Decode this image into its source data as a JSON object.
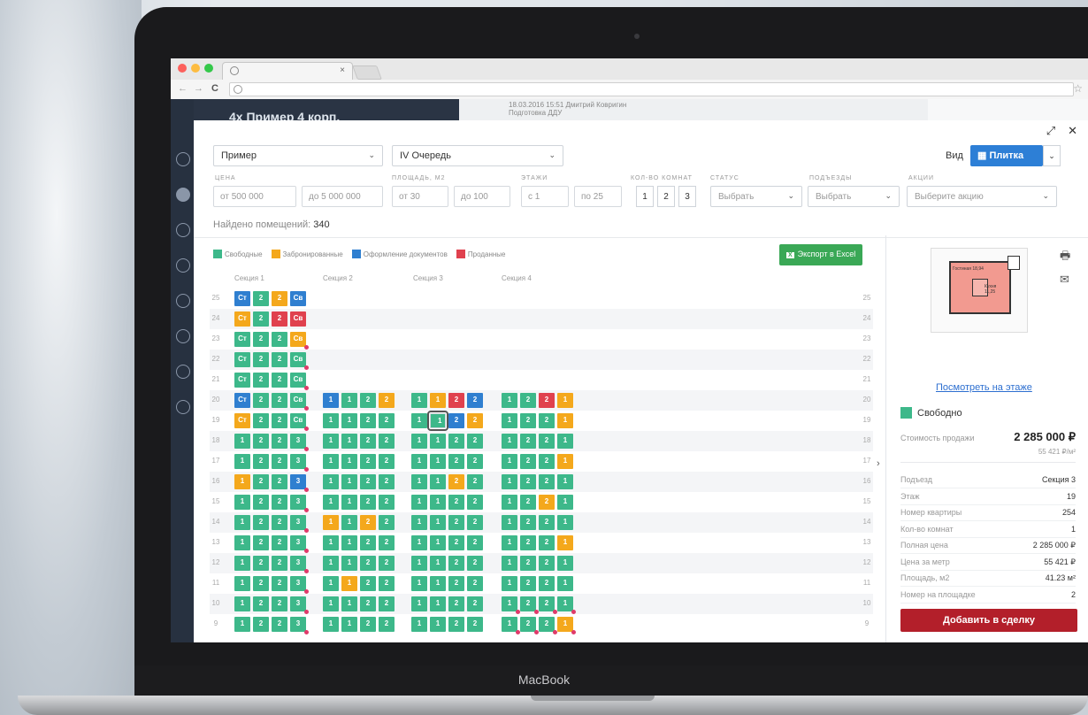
{
  "device": {
    "brand": "MacBook"
  },
  "browser": {
    "tab_close": "×",
    "nav_back": "←",
    "nav_forward": "→",
    "nav_reload": "C",
    "bookmark": "☆"
  },
  "behind": {
    "project_title": "4x Пример 4 корп.",
    "event_line1": "18.03.2016 15:51 Дмитрий Ковригин",
    "event_line2": "Подготовка ДДУ"
  },
  "modal": {
    "expand_icon": "⤢",
    "close_icon": "✕",
    "project_select": "Пример",
    "queue_select": "IV Очередь",
    "view": {
      "label": "Вид",
      "button": "Плитка"
    },
    "filters": {
      "price": {
        "label": "ЦЕНА",
        "from": "от 500 000",
        "to": "до 5 000 000"
      },
      "area": {
        "label": "ПЛОЩАДЬ, М2",
        "from": "от 30",
        "to": "до 100"
      },
      "floors": {
        "label": "ЭТАЖИ",
        "from": "с 1",
        "to": "по 25"
      },
      "rooms": {
        "label": "КОЛ-ВО КОМНАТ",
        "options": [
          "1",
          "2",
          "3"
        ]
      },
      "status": {
        "label": "СТАТУС",
        "placeholder": "Выбрать"
      },
      "entrances": {
        "label": "ПОДЪЕЗДЫ",
        "placeholder": "Выбрать"
      },
      "promo": {
        "label": "АКЦИИ",
        "placeholder": "Выберите акцию"
      }
    },
    "found": {
      "label": "Найдено помещений:",
      "count": "340"
    },
    "legend": [
      {
        "label": "Свободные",
        "color": "#3db88a"
      },
      {
        "label": "Забронированные",
        "color": "#f4a81c"
      },
      {
        "label": "Оформление документов",
        "color": "#2f7fd0"
      },
      {
        "label": "Проданные",
        "color": "#e0414e"
      }
    ],
    "export_button": "Экспорт в Excel",
    "export_badge": "X",
    "sections": [
      "Секция 1",
      "Секция 2",
      "Секция 3",
      "Секция 4"
    ],
    "floors": [
      {
        "n": "25",
        "cells": [
          [
            "Ст",
            "b"
          ],
          [
            "2",
            "g"
          ],
          [
            "2",
            "o"
          ],
          [
            "Св",
            "b"
          ]
        ]
      },
      {
        "n": "24",
        "cells": [
          [
            "Ст",
            "o"
          ],
          [
            "2",
            "g"
          ],
          [
            "2",
            "r"
          ],
          [
            "Св",
            "r"
          ]
        ]
      },
      {
        "n": "23",
        "cells": [
          [
            "Ст",
            "g"
          ],
          [
            "2",
            "g"
          ],
          [
            "2",
            "g"
          ],
          [
            "Св",
            "o"
          ]
        ]
      },
      {
        "n": "22",
        "cells": [
          [
            "Ст",
            "g"
          ],
          [
            "2",
            "g"
          ],
          [
            "2",
            "g"
          ],
          [
            "Св",
            "g"
          ]
        ]
      },
      {
        "n": "21",
        "cells": [
          [
            "Ст",
            "g"
          ],
          [
            "2",
            "g"
          ],
          [
            "2",
            "g"
          ],
          [
            "Св",
            "g"
          ]
        ]
      },
      {
        "n": "20",
        "cells": [
          [
            "Ст",
            "b"
          ],
          [
            "2",
            "g"
          ],
          [
            "2",
            "g"
          ],
          [
            "Св",
            "g"
          ],
          [
            "1",
            "b"
          ],
          [
            "1",
            "g"
          ],
          [
            "2",
            "g"
          ],
          [
            "2",
            "o"
          ],
          [
            "1",
            "g"
          ],
          [
            "1",
            "o"
          ],
          [
            "2",
            "r"
          ],
          [
            "2",
            "b"
          ],
          [
            "1",
            "g"
          ],
          [
            "2",
            "g"
          ],
          [
            "2",
            "r"
          ],
          [
            "1",
            "o"
          ]
        ]
      },
      {
        "n": "19",
        "cells": [
          [
            "Ст",
            "o"
          ],
          [
            "2",
            "g"
          ],
          [
            "2",
            "g"
          ],
          [
            "Св",
            "g"
          ],
          [
            "1",
            "g"
          ],
          [
            "1",
            "g"
          ],
          [
            "2",
            "g"
          ],
          [
            "2",
            "g"
          ],
          [
            "1",
            "g"
          ],
          [
            "1",
            "g"
          ],
          [
            "2",
            "b"
          ],
          [
            "2",
            "o"
          ],
          [
            "1",
            "g"
          ],
          [
            "2",
            "g"
          ],
          [
            "2",
            "g"
          ],
          [
            "1",
            "o"
          ]
        ]
      },
      {
        "n": "18",
        "cells": [
          [
            "1",
            "g"
          ],
          [
            "2",
            "g"
          ],
          [
            "2",
            "g"
          ],
          [
            "3",
            "g"
          ],
          [
            "1",
            "g"
          ],
          [
            "1",
            "g"
          ],
          [
            "2",
            "g"
          ],
          [
            "2",
            "g"
          ],
          [
            "1",
            "g"
          ],
          [
            "1",
            "g"
          ],
          [
            "2",
            "g"
          ],
          [
            "2",
            "g"
          ],
          [
            "1",
            "g"
          ],
          [
            "2",
            "g"
          ],
          [
            "2",
            "g"
          ],
          [
            "1",
            "g"
          ]
        ]
      },
      {
        "n": "17",
        "cells": [
          [
            "1",
            "g"
          ],
          [
            "2",
            "g"
          ],
          [
            "2",
            "g"
          ],
          [
            "3",
            "g"
          ],
          [
            "1",
            "g"
          ],
          [
            "1",
            "g"
          ],
          [
            "2",
            "g"
          ],
          [
            "2",
            "g"
          ],
          [
            "1",
            "g"
          ],
          [
            "1",
            "g"
          ],
          [
            "2",
            "g"
          ],
          [
            "2",
            "g"
          ],
          [
            "1",
            "g"
          ],
          [
            "2",
            "g"
          ],
          [
            "2",
            "g"
          ],
          [
            "1",
            "o"
          ]
        ]
      },
      {
        "n": "16",
        "cells": [
          [
            "1",
            "o"
          ],
          [
            "2",
            "g"
          ],
          [
            "2",
            "g"
          ],
          [
            "3",
            "b"
          ],
          [
            "1",
            "g"
          ],
          [
            "1",
            "g"
          ],
          [
            "2",
            "g"
          ],
          [
            "2",
            "g"
          ],
          [
            "1",
            "g"
          ],
          [
            "1",
            "g"
          ],
          [
            "2",
            "o"
          ],
          [
            "2",
            "g"
          ],
          [
            "1",
            "g"
          ],
          [
            "2",
            "g"
          ],
          [
            "2",
            "g"
          ],
          [
            "1",
            "g"
          ]
        ]
      },
      {
        "n": "15",
        "cells": [
          [
            "1",
            "g"
          ],
          [
            "2",
            "g"
          ],
          [
            "2",
            "g"
          ],
          [
            "3",
            "g"
          ],
          [
            "1",
            "g"
          ],
          [
            "1",
            "g"
          ],
          [
            "2",
            "g"
          ],
          [
            "2",
            "g"
          ],
          [
            "1",
            "g"
          ],
          [
            "1",
            "g"
          ],
          [
            "2",
            "g"
          ],
          [
            "2",
            "g"
          ],
          [
            "1",
            "g"
          ],
          [
            "2",
            "g"
          ],
          [
            "2",
            "o"
          ],
          [
            "1",
            "g"
          ]
        ]
      },
      {
        "n": "14",
        "cells": [
          [
            "1",
            "g"
          ],
          [
            "2",
            "g"
          ],
          [
            "2",
            "g"
          ],
          [
            "3",
            "g"
          ],
          [
            "1",
            "o"
          ],
          [
            "1",
            "g"
          ],
          [
            "2",
            "o"
          ],
          [
            "2",
            "g"
          ],
          [
            "1",
            "g"
          ],
          [
            "1",
            "g"
          ],
          [
            "2",
            "g"
          ],
          [
            "2",
            "g"
          ],
          [
            "1",
            "g"
          ],
          [
            "2",
            "g"
          ],
          [
            "2",
            "g"
          ],
          [
            "1",
            "g"
          ]
        ]
      },
      {
        "n": "13",
        "cells": [
          [
            "1",
            "g"
          ],
          [
            "2",
            "g"
          ],
          [
            "2",
            "g"
          ],
          [
            "3",
            "g"
          ],
          [
            "1",
            "g"
          ],
          [
            "1",
            "g"
          ],
          [
            "2",
            "g"
          ],
          [
            "2",
            "g"
          ],
          [
            "1",
            "g"
          ],
          [
            "1",
            "g"
          ],
          [
            "2",
            "g"
          ],
          [
            "2",
            "g"
          ],
          [
            "1",
            "g"
          ],
          [
            "2",
            "g"
          ],
          [
            "2",
            "g"
          ],
          [
            "1",
            "o"
          ]
        ]
      },
      {
        "n": "12",
        "cells": [
          [
            "1",
            "g"
          ],
          [
            "2",
            "g"
          ],
          [
            "2",
            "g"
          ],
          [
            "3",
            "g"
          ],
          [
            "1",
            "g"
          ],
          [
            "1",
            "g"
          ],
          [
            "2",
            "g"
          ],
          [
            "2",
            "g"
          ],
          [
            "1",
            "g"
          ],
          [
            "1",
            "g"
          ],
          [
            "2",
            "g"
          ],
          [
            "2",
            "g"
          ],
          [
            "1",
            "g"
          ],
          [
            "2",
            "g"
          ],
          [
            "2",
            "g"
          ],
          [
            "1",
            "g"
          ]
        ]
      },
      {
        "n": "11",
        "cells": [
          [
            "1",
            "g"
          ],
          [
            "2",
            "g"
          ],
          [
            "2",
            "g"
          ],
          [
            "3",
            "g"
          ],
          [
            "1",
            "g"
          ],
          [
            "1",
            "o"
          ],
          [
            "2",
            "g"
          ],
          [
            "2",
            "g"
          ],
          [
            "1",
            "g"
          ],
          [
            "1",
            "g"
          ],
          [
            "2",
            "g"
          ],
          [
            "2",
            "g"
          ],
          [
            "1",
            "g"
          ],
          [
            "2",
            "g"
          ],
          [
            "2",
            "g"
          ],
          [
            "1",
            "g"
          ]
        ]
      },
      {
        "n": "10",
        "cells": [
          [
            "1",
            "g"
          ],
          [
            "2",
            "g"
          ],
          [
            "2",
            "g"
          ],
          [
            "3",
            "g"
          ],
          [
            "1",
            "g"
          ],
          [
            "1",
            "g"
          ],
          [
            "2",
            "g"
          ],
          [
            "2",
            "g"
          ],
          [
            "1",
            "g"
          ],
          [
            "1",
            "g"
          ],
          [
            "2",
            "g"
          ],
          [
            "2",
            "g"
          ],
          [
            "1",
            "g"
          ],
          [
            "2",
            "g"
          ],
          [
            "2",
            "g"
          ],
          [
            "1",
            "g"
          ]
        ]
      },
      {
        "n": "9",
        "cells": [
          [
            "1",
            "g"
          ],
          [
            "2",
            "g"
          ],
          [
            "2",
            "g"
          ],
          [
            "3",
            "g"
          ],
          [
            "1",
            "g"
          ],
          [
            "1",
            "g"
          ],
          [
            "2",
            "g"
          ],
          [
            "2",
            "g"
          ],
          [
            "1",
            "g"
          ],
          [
            "1",
            "g"
          ],
          [
            "2",
            "g"
          ],
          [
            "2",
            "g"
          ],
          [
            "1",
            "g"
          ],
          [
            "2",
            "g"
          ],
          [
            "2",
            "g"
          ],
          [
            "1",
            "o"
          ]
        ]
      }
    ],
    "detail": {
      "plan_label_1": "Гостиная 18,94",
      "plan_label_2": "Кухня 11,25",
      "print_icon": "🖶",
      "mail_icon": "✉",
      "expander": "›",
      "link": "Посмотреть на этаже",
      "status": "Свободно",
      "sale_label": "Стоимость продажи",
      "sale_price": "2 285 000 ₽",
      "price_per_m": "55 421 ₽/м²",
      "props": [
        {
          "k": "Подъезд",
          "v": "Секция 3"
        },
        {
          "k": "Этаж",
          "v": "19"
        },
        {
          "k": "Номер квартиры",
          "v": "254"
        },
        {
          "k": "Кол-во комнат",
          "v": "1"
        },
        {
          "k": "Полная цена",
          "v": "2 285 000 ₽"
        },
        {
          "k": "Цена за метр",
          "v": "55 421 ₽"
        },
        {
          "k": "Площадь, м2",
          "v": "41.23 м²"
        },
        {
          "k": "Номер на площадке",
          "v": "2"
        }
      ],
      "add_button": "Добавить в сделку"
    }
  }
}
